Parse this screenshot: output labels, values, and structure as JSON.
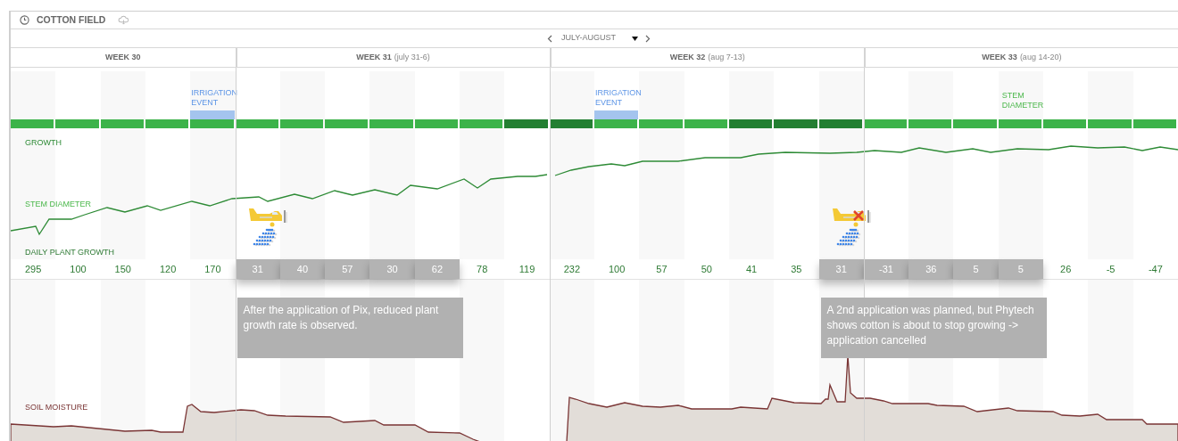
{
  "header": {
    "title": "COTTON FIELD"
  },
  "nav": {
    "period": "JULY-AUGUST"
  },
  "labels": {
    "growth": "GROWTH",
    "stem_diameter": "STEM DIAMETER",
    "daily_growth": "DAILY PLANT GROWTH",
    "soil_moisture": "SOIL MOISTURE"
  },
  "weeks": [
    {
      "label": "WEEK 30",
      "days": [
        {
          "value": "295",
          "strong": false,
          "highlighted": false
        },
        {
          "value": "100",
          "strong": false,
          "highlighted": false
        },
        {
          "value": "150",
          "strong": false,
          "highlighted": false
        },
        {
          "value": "120",
          "strong": false,
          "highlighted": false
        },
        {
          "value": "170",
          "strong": false,
          "highlighted": false,
          "event": {
            "kind": "irrigation",
            "label": "IRRIGATION EVENT"
          }
        }
      ]
    },
    {
      "label": "WEEK 31",
      "range": "(july 31-6)",
      "days": [
        {
          "value": "31",
          "strong": false,
          "highlighted": true,
          "spray": {
            "cancelled": false
          },
          "note": "After the application of Pix, reduced plant growth rate is observed."
        },
        {
          "value": "40",
          "strong": false,
          "highlighted": true
        },
        {
          "value": "57",
          "strong": false,
          "highlighted": true
        },
        {
          "value": "30",
          "strong": false,
          "highlighted": true
        },
        {
          "value": "62",
          "strong": false,
          "highlighted": true
        },
        {
          "value": "78",
          "strong": false,
          "highlighted": false
        },
        {
          "value": "119",
          "strong": true,
          "highlighted": false
        }
      ]
    },
    {
      "label": "WEEK 32",
      "range": "(aug 7-13)",
      "days": [
        {
          "value": "232",
          "strong": true,
          "highlighted": false
        },
        {
          "value": "100",
          "strong": false,
          "highlighted": false,
          "event": {
            "kind": "irrigation",
            "label": "IRRIGATION EVENT"
          }
        },
        {
          "value": "57",
          "strong": false,
          "highlighted": false
        },
        {
          "value": "50",
          "strong": false,
          "highlighted": false
        },
        {
          "value": "41",
          "strong": true,
          "highlighted": false
        },
        {
          "value": "35",
          "strong": true,
          "highlighted": false
        },
        {
          "value": "31",
          "strong": true,
          "highlighted": true,
          "spray": {
            "cancelled": true
          },
          "note": "A 2nd application was planned, but Phytech shows cotton is about to stop growing -> application cancelled"
        }
      ]
    },
    {
      "label": "WEEK 33",
      "range": "(aug 14-20)",
      "days": [
        {
          "value": "-31",
          "strong": false,
          "highlighted": true
        },
        {
          "value": "36",
          "strong": false,
          "highlighted": true
        },
        {
          "value": "5",
          "strong": false,
          "highlighted": true
        },
        {
          "value": "5",
          "strong": false,
          "highlighted": true,
          "event": {
            "kind": "stem_diameter",
            "label": "STEM DIAMETER"
          }
        },
        {
          "value": "26",
          "strong": false,
          "highlighted": false
        },
        {
          "value": "-5",
          "strong": false,
          "highlighted": false
        },
        {
          "value": "-47",
          "strong": false,
          "highlighted": false
        }
      ]
    }
  ]
}
